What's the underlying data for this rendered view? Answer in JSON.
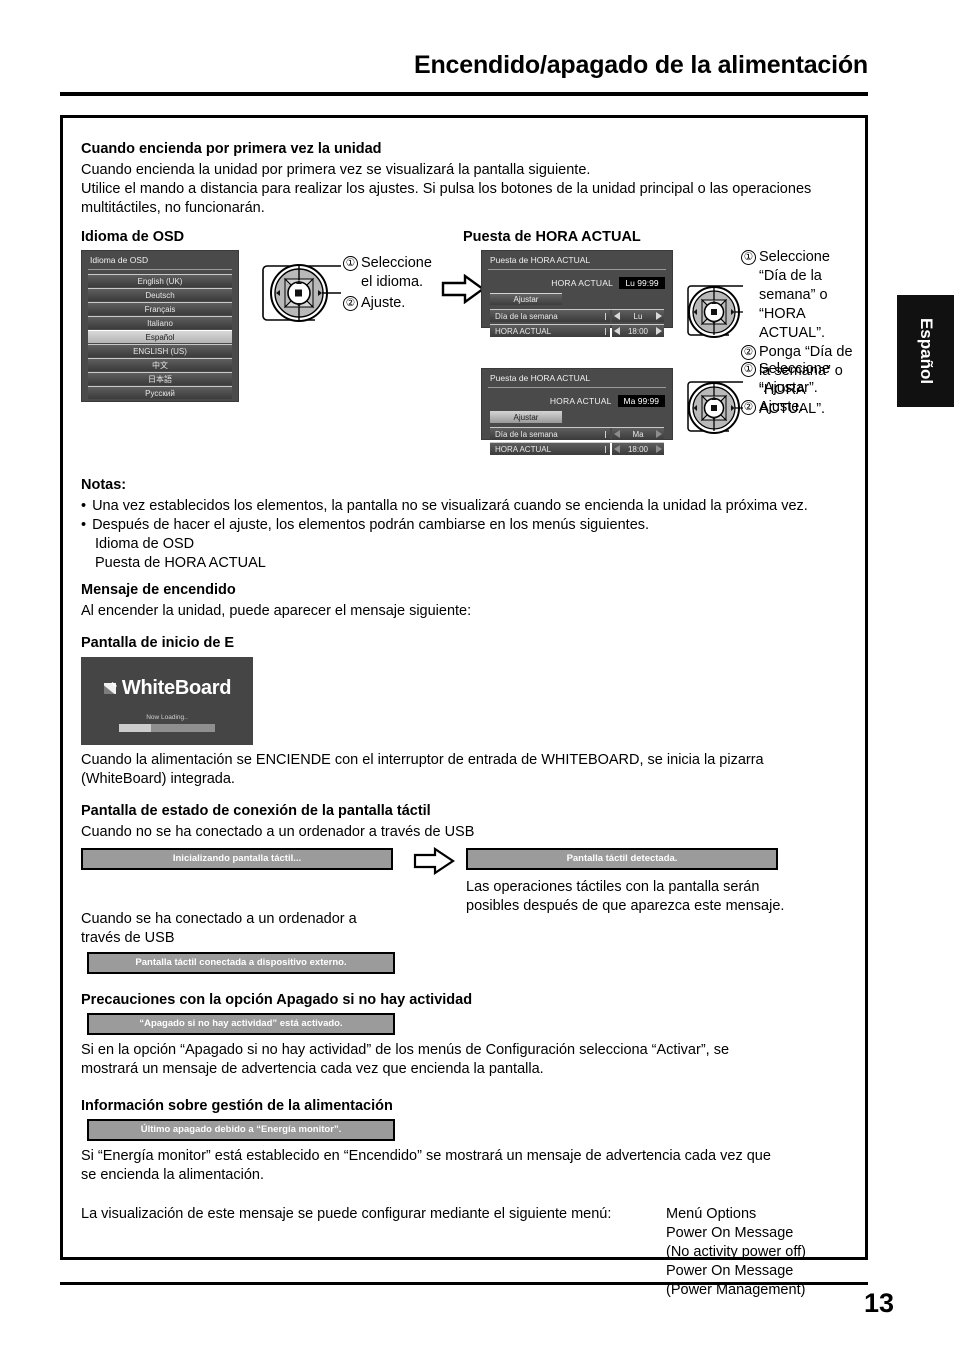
{
  "header": {
    "title": "Encendido/apagado de la alimentación"
  },
  "side_tab": {
    "label": "Español"
  },
  "page": {
    "number": "13"
  },
  "sections": {
    "first_power": {
      "heading": "Cuando encienda por primera vez la unidad",
      "line1": "Cuando encienda la unidad por primera vez se visualizará la pantalla siguiente.",
      "line2": "Utilice el mando a distancia para realizar los ajustes. Si pulsa los botones de la unidad principal o las operaciones",
      "line3": "multitáctiles, no funcionarán."
    },
    "osd_language": {
      "heading": "Idioma de OSD",
      "panel_title": "Idioma de OSD",
      "items": [
        "English (UK)",
        "Deutsch",
        "Français",
        "Italiano",
        "Español",
        "ENGLISH (US)",
        "中文",
        "日本語",
        "Русский"
      ],
      "selected_index": 4,
      "steps": [
        {
          "num": "①",
          "text": "Seleccione el idioma."
        },
        {
          "num": "②",
          "text": "Ajuste."
        }
      ]
    },
    "clock_setup": {
      "heading": "Puesta de HORA ACTUAL",
      "panel1": {
        "title": "Puesta de HORA ACTUAL",
        "current_label": "HORA ACTUAL",
        "current_value": "Lu  99:99",
        "button": "Ajustar",
        "rows": [
          {
            "name": "Día de la semana",
            "value": "Lu"
          },
          {
            "name": "HORA ACTUAL",
            "value": "18:00"
          }
        ]
      },
      "panel2": {
        "title": "Puesta de HORA ACTUAL",
        "current_label": "HORA ACTUAL",
        "current_value": "Ma  99:99",
        "button": "Ajustar",
        "rows": [
          {
            "name": "Día de la semana",
            "value": "Ma"
          },
          {
            "name": "HORA ACTUAL",
            "value": "18:00"
          }
        ]
      },
      "steps_top": [
        {
          "num": "①",
          "text": "Seleccione “Día de la semana” o “HORA ACTUAL”."
        },
        {
          "num": "②",
          "text": "Ponga “Día de la semana” o “HORA ACTUAL”."
        }
      ],
      "steps_bottom": [
        {
          "num": "①",
          "text": "Seleccione “Ajustar”."
        },
        {
          "num": "②",
          "text": "Ajuste."
        }
      ]
    },
    "notes": {
      "heading": "Notas:",
      "bullets": [
        "Una vez establecidos los elementos, la pantalla no se visualizará cuando se encienda la unidad la próxima vez.",
        "Después de hacer el ajuste, los elementos podrán cambiarse en los menús siguientes."
      ],
      "sub_items": [
        "Idioma de OSD",
        "Puesta de HORA ACTUAL"
      ]
    },
    "power_message": {
      "heading": "Mensaje de encendido",
      "text": "Al encender la unidad, puede aparecer el mensaje siguiente:"
    },
    "whiteboard": {
      "heading": "Pantalla de inicio de E",
      "splash": {
        "logo_text": "WhiteBoard",
        "loading_text": "Now Loading..",
        "mark_icon": "pen-whiteboard-icon"
      },
      "line1": "Cuando la alimentación se ENCIENDE con el interruptor de entrada de WHITEBOARD, se inicia la pizarra",
      "line2": "(WhiteBoard) integrada."
    },
    "touch_status": {
      "heading": "Pantalla de estado de conexión de la pantalla táctil",
      "case1_label": "Cuando no se ha conectado a un ordenador a través de USB",
      "msg_initializing": "Inicializando pantalla táctil...",
      "msg_detected": "Pantalla táctil detectada.",
      "detected_note_line1": "Las operaciones táctiles con la pantalla serán",
      "detected_note_line2": "posibles después de que aparezca este mensaje.",
      "case2_label_line1": "Cuando se ha conectado a un ordenador a",
      "case2_label_line2": "través de USB",
      "msg_connected": "Pantalla táctil conectada a dispositivo externo."
    },
    "no_activity": {
      "heading": "Precauciones con la opción Apagado si no hay actividad",
      "msg": "“Apagado si no hay actividad” está activado.",
      "line1": "Si en la opción “Apagado si no hay actividad” de los menús de Configuración selecciona “Activar”, se",
      "line2": "mostrará un mensaje de advertencia cada vez que encienda la pantalla."
    },
    "power_management": {
      "heading": "Información sobre gestión de la alimentación",
      "msg": "Último apagado debido a “Energía monitor”.",
      "line1": "Si “Energía monitor” está establecido en “Encendido” se mostrará un mensaje de advertencia cada vez que",
      "line2": "se encienda la alimentación.",
      "config_intro": "La visualización de este mensaje se puede configurar mediante el siguiente menú:",
      "menu_lines": [
        "Menú Options",
        "Power On Message",
        "(No activity power off)",
        "Power On Message",
        "(Power Management)"
      ]
    }
  }
}
